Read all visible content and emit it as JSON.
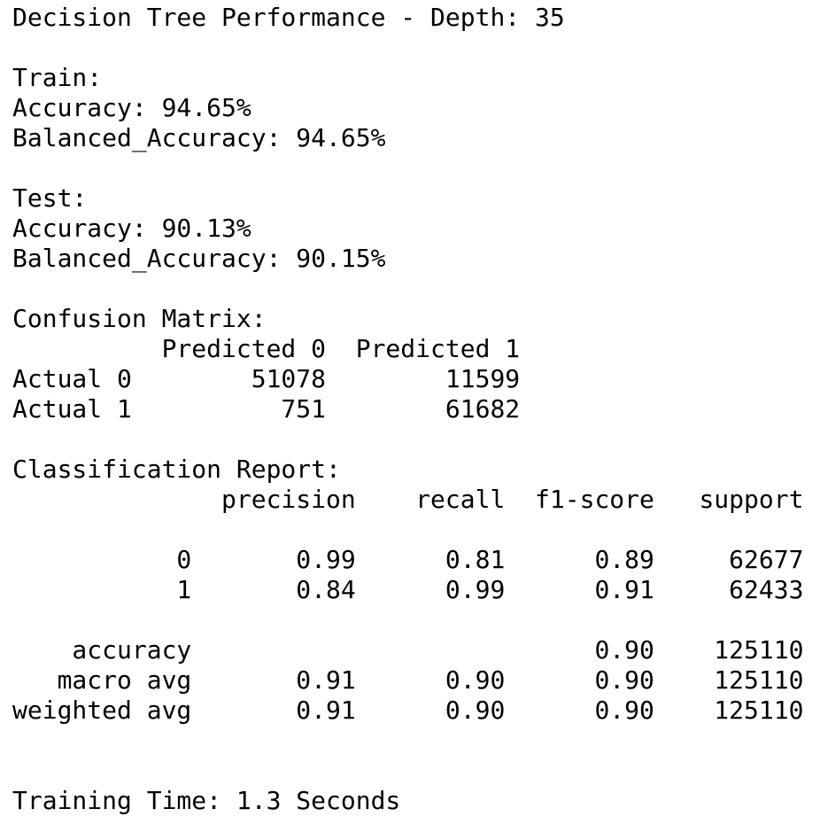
{
  "lines": [
    "Decision Tree Performance - Depth: 35",
    "",
    "Train:",
    "Accuracy: 94.65%",
    "Balanced_Accuracy: 94.65%",
    "",
    "Test:",
    "Accuracy: 90.13%",
    "Balanced_Accuracy: 90.15%",
    "",
    "Confusion Matrix:",
    "          Predicted 0  Predicted 1",
    "Actual 0        51078        11599",
    "Actual 1          751        61682",
    "",
    "Classification Report:",
    "              precision    recall  f1-score   support",
    "",
    "           0       0.99      0.81      0.89     62677",
    "           1       0.84      0.99      0.91     62433",
    "",
    "    accuracy                           0.90    125110",
    "   macro avg       0.91      0.90      0.90    125110",
    "weighted avg       0.91      0.90      0.90    125110",
    "",
    "",
    "Training Time: 1.3 Seconds"
  ]
}
